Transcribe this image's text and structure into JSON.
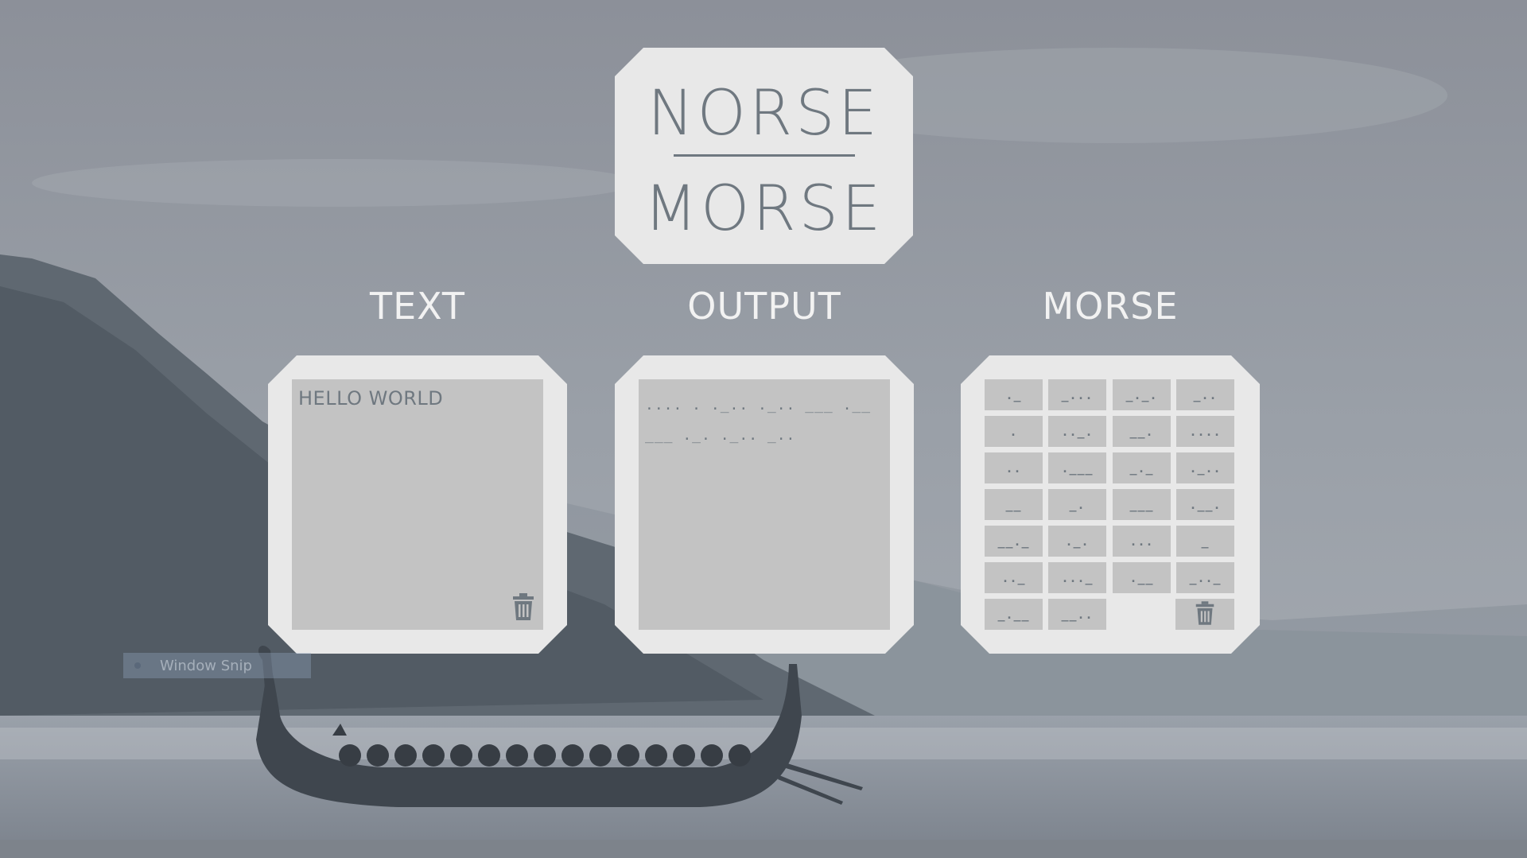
{
  "logo": {
    "top": "NORSE",
    "bottom": "MORSE"
  },
  "headings": {
    "text": "TEXT",
    "output": "OUTPUT",
    "morse": "MORSE"
  },
  "text_panel": {
    "value": "HELLO WORLD",
    "clear_icon": "trash-icon"
  },
  "output_panel": {
    "value": ".... . ._.. ._.. ___ .__ ___ ._. ._.. _.."
  },
  "morse_keys": [
    "._",
    "_...",
    "_._.",
    "_..",
    ".",
    ".._.",
    "__.",
    "....",
    "..",
    ".___",
    "_._",
    "._..",
    "__",
    "_.",
    "___",
    ".__.",
    "__._",
    "._.",
    "...",
    "_",
    ".._",
    "..._",
    ".__",
    "_.._",
    "_.__",
    "__.."
  ],
  "morse_clear_icon": "trash-icon",
  "ghost_overlay": {
    "label": "Window Snip"
  },
  "colors": {
    "panel": "#e8e8e8",
    "inner": "#c3c3c3",
    "text": "#6f7880",
    "heading": "#f2f2f2"
  }
}
